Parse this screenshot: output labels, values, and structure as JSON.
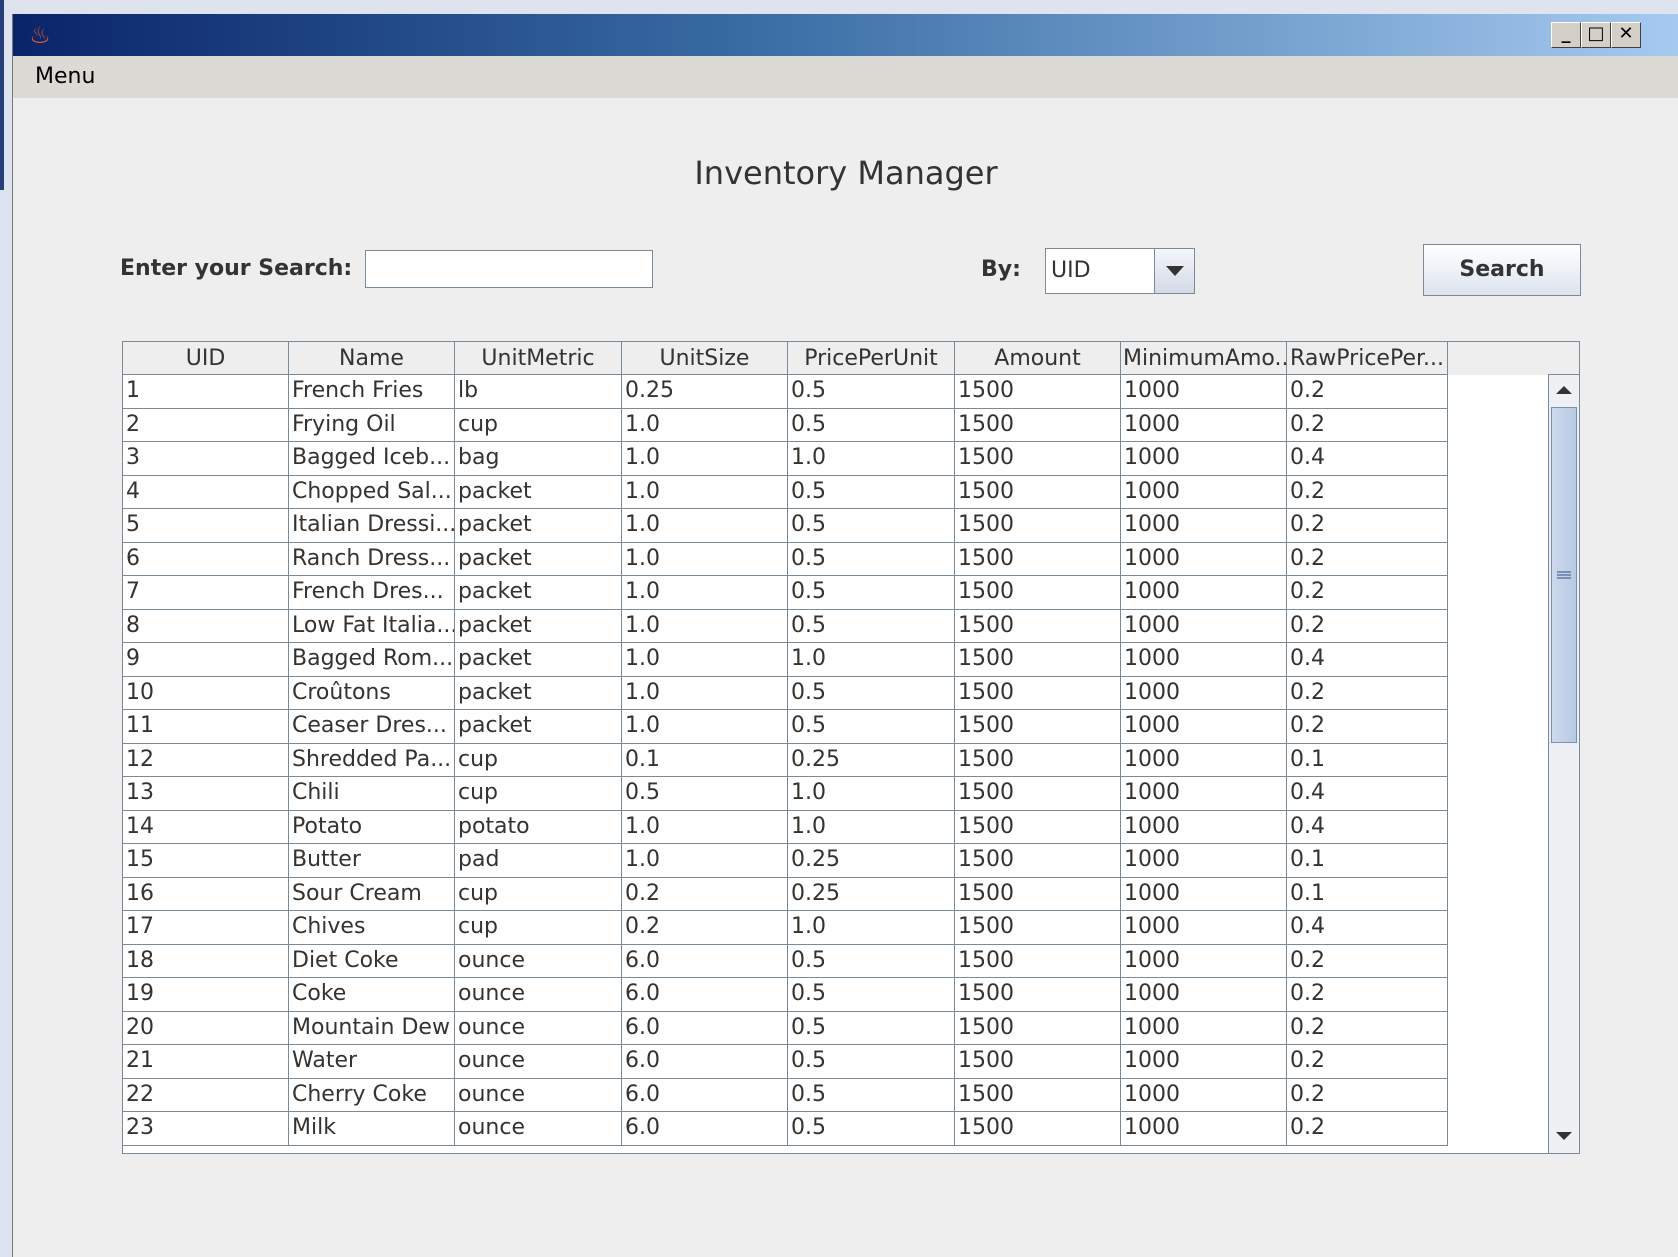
{
  "window": {
    "title": "",
    "controls": [
      "minimize",
      "maximize",
      "close"
    ]
  },
  "menubar": {
    "menu_label": "Menu"
  },
  "page_title": "Inventory Manager",
  "search": {
    "label": "Enter your Search:",
    "value": "",
    "by_label": "By:",
    "by_selected": "UID",
    "button_label": "Search"
  },
  "table": {
    "columns": [
      "UID",
      "Name",
      "UnitMetric",
      "UnitSize",
      "PricePerUnit",
      "Amount",
      "MinimumAmo...",
      "RawPricePer..."
    ],
    "rows": [
      [
        "1",
        "French Fries",
        "lb",
        "0.25",
        "0.5",
        "1500",
        "1000",
        "0.2"
      ],
      [
        "2",
        "Frying Oil",
        "cup",
        "1.0",
        "0.5",
        "1500",
        "1000",
        "0.2"
      ],
      [
        "3",
        "Bagged Iceb...",
        "bag",
        "1.0",
        "1.0",
        "1500",
        "1000",
        "0.4"
      ],
      [
        "4",
        "Chopped Sal...",
        "packet",
        "1.0",
        "0.5",
        "1500",
        "1000",
        "0.2"
      ],
      [
        "5",
        "Italian Dressi...",
        "packet",
        "1.0",
        "0.5",
        "1500",
        "1000",
        "0.2"
      ],
      [
        "6",
        "Ranch Dress...",
        "packet",
        "1.0",
        "0.5",
        "1500",
        "1000",
        "0.2"
      ],
      [
        "7",
        "French Dres...",
        "packet",
        "1.0",
        "0.5",
        "1500",
        "1000",
        "0.2"
      ],
      [
        "8",
        "Low Fat Italia...",
        "packet",
        "1.0",
        "0.5",
        "1500",
        "1000",
        "0.2"
      ],
      [
        "9",
        "Bagged Rom...",
        "packet",
        "1.0",
        "1.0",
        "1500",
        "1000",
        "0.4"
      ],
      [
        "10",
        "Croûtons",
        "packet",
        "1.0",
        "0.5",
        "1500",
        "1000",
        "0.2"
      ],
      [
        "11",
        "Ceaser Dres...",
        "packet",
        "1.0",
        "0.5",
        "1500",
        "1000",
        "0.2"
      ],
      [
        "12",
        "Shredded Pa...",
        "cup",
        "0.1",
        "0.25",
        "1500",
        "1000",
        "0.1"
      ],
      [
        "13",
        "Chili",
        "cup",
        "0.5",
        "1.0",
        "1500",
        "1000",
        "0.4"
      ],
      [
        "14",
        "Potato",
        "potato",
        "1.0",
        "1.0",
        "1500",
        "1000",
        "0.4"
      ],
      [
        "15",
        "Butter",
        "pad",
        "1.0",
        "0.25",
        "1500",
        "1000",
        "0.1"
      ],
      [
        "16",
        "Sour Cream",
        "cup",
        "0.2",
        "0.25",
        "1500",
        "1000",
        "0.1"
      ],
      [
        "17",
        "Chives",
        "cup",
        "0.2",
        "1.0",
        "1500",
        "1000",
        "0.4"
      ],
      [
        "18",
        "Diet Coke",
        "ounce",
        "6.0",
        "0.5",
        "1500",
        "1000",
        "0.2"
      ],
      [
        "19",
        "Coke",
        "ounce",
        "6.0",
        "0.5",
        "1500",
        "1000",
        "0.2"
      ],
      [
        "20",
        "Mountain Dew",
        "ounce",
        "6.0",
        "0.5",
        "1500",
        "1000",
        "0.2"
      ],
      [
        "21",
        "Water",
        "ounce",
        "6.0",
        "0.5",
        "1500",
        "1000",
        "0.2"
      ],
      [
        "22",
        "Cherry Coke",
        "ounce",
        "6.0",
        "0.5",
        "1500",
        "1000",
        "0.2"
      ],
      [
        "23",
        "Milk",
        "ounce",
        "6.0",
        "0.5",
        "1500",
        "1000",
        "0.2"
      ]
    ]
  },
  "icons": {
    "app": "java-coffee-icon",
    "minimize": "minimize-icon",
    "maximize": "maximize-icon",
    "close": "close-icon",
    "dropdown": "chevron-down-icon"
  },
  "colors": {
    "titlebar_start": "#0a246a",
    "titlebar_end": "#a6caf0",
    "panel_bg": "#eeeeee",
    "grid_line": "#7a8a99",
    "scroll_thumb": "#b8c9e3"
  }
}
